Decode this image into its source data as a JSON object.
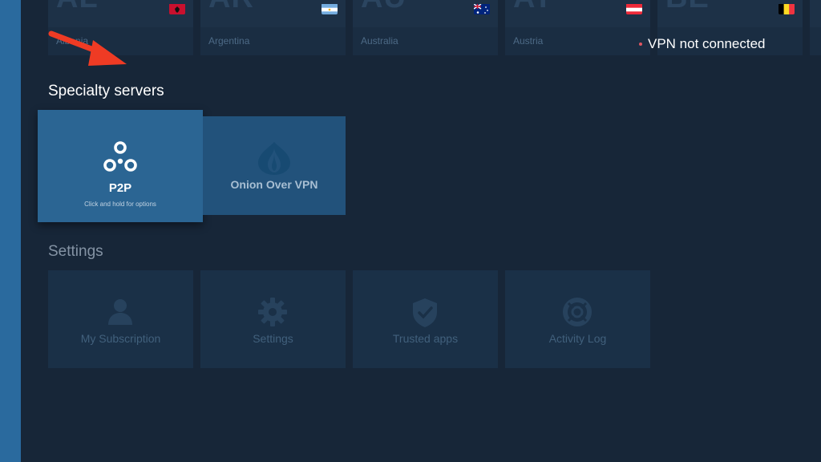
{
  "countries": [
    {
      "code": "AL",
      "name": "Albania",
      "flag": "albania-flag-icon"
    },
    {
      "code": "AR",
      "name": "Argentina",
      "flag": "argentina-flag-icon"
    },
    {
      "code": "AU",
      "name": "Australia",
      "flag": "australia-flag-icon"
    },
    {
      "code": "AT",
      "name": "Austria",
      "flag": "austria-flag-icon"
    },
    {
      "code": "BE",
      "name": "",
      "flag": "belgium-flag-icon"
    }
  ],
  "status": {
    "vpn_text": "VPN not connected",
    "dot_color": "#e05561"
  },
  "specialty": {
    "title": "Specialty servers",
    "p2p": {
      "label": "P2P",
      "hint": "Click and hold for options",
      "icon": "p2p-icon"
    },
    "onion": {
      "label": "Onion Over VPN",
      "icon": "onion-icon"
    }
  },
  "settings": {
    "title": "Settings",
    "tiles": [
      {
        "label": "My Subscription",
        "icon": "user-icon"
      },
      {
        "label": "Settings",
        "icon": "gear-icon"
      },
      {
        "label": "Trusted apps",
        "icon": "shield-check-icon"
      },
      {
        "label": "Activity Log",
        "icon": "lifebuoy-icon"
      }
    ]
  },
  "colors": {
    "background": "#172638",
    "accent": "#2b6593",
    "rail": "#2a6a9e",
    "annotation_arrow": "#ef3b24"
  }
}
